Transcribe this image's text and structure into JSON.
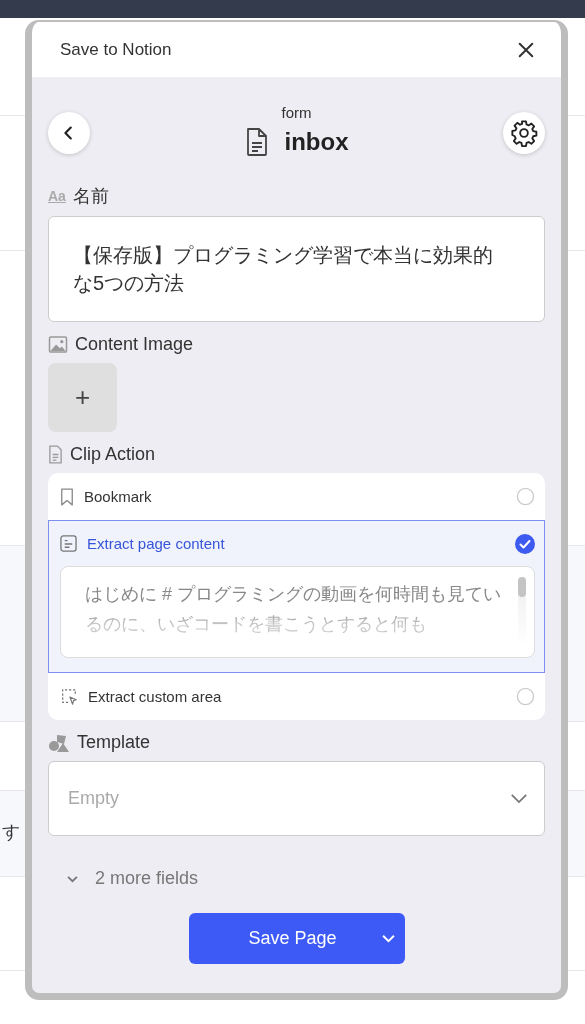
{
  "background": {
    "page_text": "す"
  },
  "dialog": {
    "title": "Save to Notion"
  },
  "header": {
    "type_label": "form",
    "database": "inbox"
  },
  "fields": [
    {
      "kind": "text",
      "label": "名前",
      "icon_text": "Aa",
      "value": "【保存版】プログラミング学習で本当に効果的な5つの方法"
    },
    {
      "kind": "image",
      "label": "Content Image",
      "button": "+"
    },
    {
      "kind": "choice",
      "label": "Clip Action",
      "options": [
        {
          "label": "Bookmark",
          "selected": false
        },
        {
          "label": "Extract page content",
          "selected": true,
          "preview": "はじめに # プログラミングの動画を何時間も見ているのに、いざコードを書こうとすると何も"
        },
        {
          "label": "Extract custom area",
          "selected": false
        }
      ]
    },
    {
      "kind": "select",
      "label": "Template",
      "placeholder": "Empty"
    }
  ],
  "more_fields": {
    "label": "2 more fields",
    "expanded": false
  },
  "save_button": {
    "label": "Save Page"
  }
}
